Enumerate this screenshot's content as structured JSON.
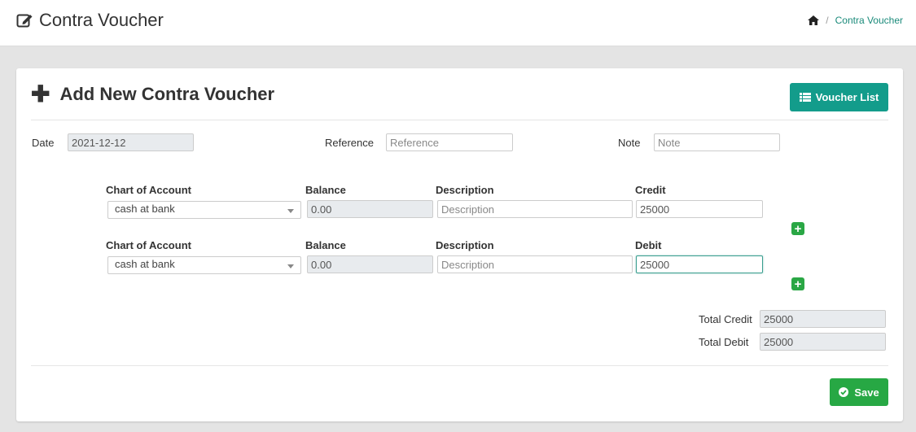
{
  "header": {
    "title": "Contra Voucher",
    "breadcrumb": {
      "separator": "/",
      "current": "Contra Voucher"
    }
  },
  "form": {
    "title": "Add New Contra Voucher",
    "voucher_list_label": "Voucher List",
    "date_label": "Date",
    "date_value": "2021-12-12",
    "reference_label": "Reference",
    "reference_placeholder": "Reference",
    "note_label": "Note",
    "note_placeholder": "Note",
    "rows": [
      {
        "account_label": "Chart of Account",
        "account_value": "cash at bank",
        "balance_label": "Balance",
        "balance_value": "0.00",
        "description_label": "Description",
        "description_placeholder": "Description",
        "amount_label": "Credit",
        "amount_value": "25000"
      },
      {
        "account_label": "Chart of Account",
        "account_value": "cash at bank",
        "balance_label": "Balance",
        "balance_value": "0.00",
        "description_label": "Description",
        "description_placeholder": "Description",
        "amount_label": "Debit",
        "amount_value": "25000"
      }
    ],
    "total_credit_label": "Total Credit",
    "total_credit_value": "25000",
    "total_debit_label": "Total Debit",
    "total_debit_value": "25000",
    "save_label": "Save"
  },
  "colors": {
    "teal": "#139c8b",
    "green": "#27a844",
    "breadcrumb_link": "#1a8a7a"
  },
  "icons": [
    "edit-icon",
    "home-icon",
    "plus-icon",
    "list-icon",
    "check-circle-icon",
    "add-row-icon"
  ]
}
